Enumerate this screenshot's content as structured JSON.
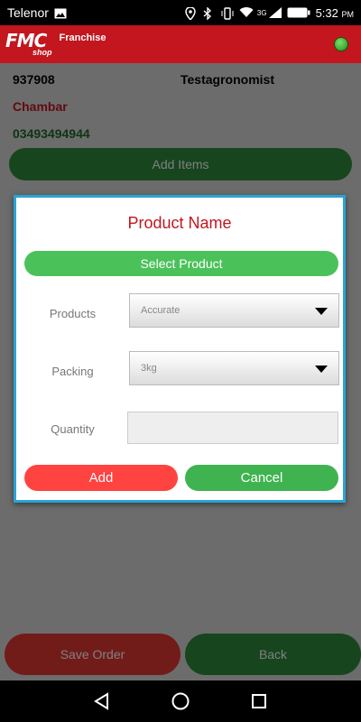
{
  "status_bar": {
    "carrier": "Telenor",
    "network": "3G",
    "battery": "91",
    "time": "5:32",
    "ampm": "PM"
  },
  "header": {
    "logo_main": "FMC",
    "logo_sub": "shop",
    "franchise_label": "Franchise",
    "status_color": "#3dbb2f"
  },
  "info": {
    "code": "937908",
    "role": "Testagronomist",
    "place": "Chambar",
    "phone": "03493494944"
  },
  "buttons": {
    "add_items": "Add Items",
    "save_order": "Save Order",
    "back": "Back"
  },
  "dialog": {
    "title": "Product Name",
    "select_product": "Select Product",
    "products_label": "Products",
    "products_value": "Accurate",
    "packing_label": "Packing",
    "packing_value": "3kg",
    "quantity_label": "Quantity",
    "quantity_value": "",
    "add_label": "Add",
    "cancel_label": "Cancel"
  },
  "colors": {
    "brand_red": "#c3161e",
    "green": "#2e8b3c",
    "dialog_border": "#29a3d6"
  },
  "nav": {
    "back_icon": "triangle-back-icon",
    "home_icon": "circle-home-icon",
    "recents_icon": "square-recents-icon"
  }
}
